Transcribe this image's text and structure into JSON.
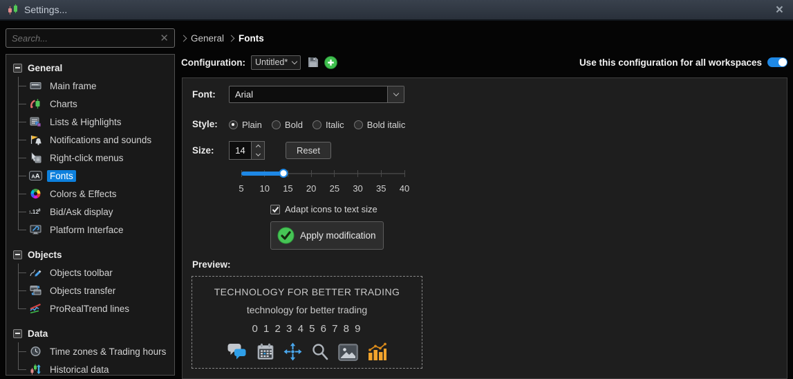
{
  "window": {
    "title": "Settings..."
  },
  "sidebar": {
    "search_placeholder": "Search...",
    "groups": [
      {
        "label": "General",
        "items": [
          {
            "label": "Main frame",
            "icon": "main-frame-icon"
          },
          {
            "label": "Charts",
            "icon": "charts-icon"
          },
          {
            "label": "Lists & Highlights",
            "icon": "lists-highlights-icon"
          },
          {
            "label": "Notifications and sounds",
            "icon": "notifications-icon"
          },
          {
            "label": "Right-click menus",
            "icon": "right-click-menu-icon"
          },
          {
            "label": "Fonts",
            "icon": "fonts-icon",
            "selected": true
          },
          {
            "label": "Colors & Effects",
            "icon": "colors-effects-icon"
          },
          {
            "label": "Bid/Ask display",
            "icon": "bid-ask-icon"
          },
          {
            "label": "Platform Interface",
            "icon": "platform-interface-icon"
          }
        ]
      },
      {
        "label": "Objects",
        "items": [
          {
            "label": "Objects toolbar",
            "icon": "objects-toolbar-icon"
          },
          {
            "label": "Objects transfer",
            "icon": "objects-transfer-icon"
          },
          {
            "label": "ProRealTrend lines",
            "icon": "proreal-trend-icon"
          }
        ]
      },
      {
        "label": "Data",
        "items": [
          {
            "label": "Time zones & Trading hours",
            "icon": "time-zones-icon"
          },
          {
            "label": "Historical data",
            "icon": "historical-data-icon"
          }
        ]
      }
    ]
  },
  "breadcrumb": {
    "parent": "General",
    "current": "Fonts"
  },
  "configuration": {
    "label": "Configuration:",
    "value": "Untitled*",
    "save_icon": "save-icon",
    "add_icon": "add-config-icon",
    "workspace_toggle_label": "Use this configuration for all workspaces",
    "toggle_on": true
  },
  "font_form": {
    "font_label": "Font:",
    "font_value": "Arial",
    "style_label": "Style:",
    "styles": [
      {
        "label": "Plain",
        "selected": true
      },
      {
        "label": "Bold",
        "selected": false
      },
      {
        "label": "Italic",
        "selected": false
      },
      {
        "label": "Bold italic",
        "selected": false
      }
    ],
    "size_label": "Size:",
    "size_value": "14",
    "reset_label": "Reset",
    "slider": {
      "min": 5,
      "max": 40,
      "value": 14,
      "ticks": [
        "5",
        "10",
        "15",
        "20",
        "25",
        "30",
        "35",
        "40"
      ]
    },
    "adapt_label": "Adapt icons to text size",
    "adapt_checked": true,
    "apply_label": "Apply modification"
  },
  "preview": {
    "label": "Preview:",
    "line_upper": "TECHNOLOGY FOR BETTER TRADING",
    "line_lower": "technology for better trading",
    "line_digits": "0 1 2 3 4 5 6 7 8 9",
    "icons": [
      "chat-icon",
      "calendar-icon",
      "move-icon",
      "search-icon",
      "image-icon",
      "chart-icon"
    ]
  },
  "colors": {
    "accent_blue": "#1e88e5",
    "selected_blue": "#0d80dd",
    "green": "#3fbf4e"
  }
}
